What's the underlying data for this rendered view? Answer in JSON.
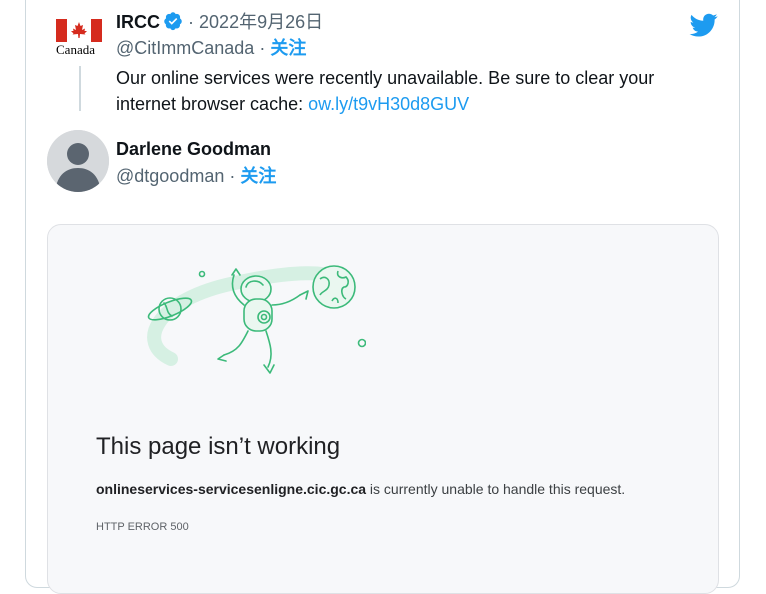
{
  "tweet": {
    "author_name": "IRCC",
    "separator": "·",
    "date": "2022年9月26日",
    "handle": "@CitImmCanada",
    "follow_label": "关注",
    "text": "Our online services were recently unavailable. Be sure to clear your internet browser cache:",
    "link_text": "ow.ly/t9vH30d8GUV",
    "logo_word": "Canada"
  },
  "reply": {
    "author_name": "Darlene Goodman",
    "handle": "@dtgoodman",
    "separator": "·",
    "follow_label": "关注"
  },
  "error_page": {
    "title": "This page isn’t working",
    "host": "onlineservices-servicesenligne.cic.gc.ca",
    "message": " is currently unable to handle this request.",
    "code": "HTTP ERROR 500"
  },
  "colors": {
    "accent": "#1d9bf0",
    "text": "#0f1419",
    "muted": "#536471",
    "flag_red": "#d52b1e",
    "illustration_green": "#3cba7a"
  },
  "icons": [
    "twitter-bird-icon",
    "verified-badge-icon",
    "canada-flag-icon",
    "default-avatar-icon",
    "astronaut-illustration"
  ]
}
